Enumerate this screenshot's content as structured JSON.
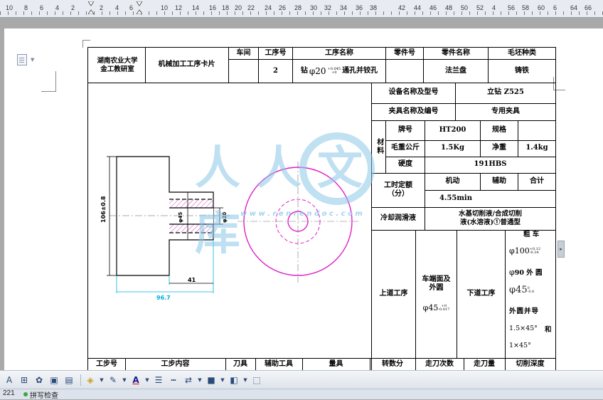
{
  "ruler": {
    "labels": [
      "10",
      "8",
      "6",
      "4",
      "2",
      "2",
      "4",
      "6",
      "10",
      "12",
      "14",
      "16",
      "18",
      "20",
      "22",
      "24",
      "26",
      "28",
      "30",
      "32",
      "34",
      "36",
      "38",
      "42",
      "44",
      "46",
      "48",
      "50",
      "52",
      "4",
      "56",
      "58",
      "60",
      "6",
      "64",
      "66"
    ]
  },
  "card": {
    "school": "湖南农业大学\n金工教研室",
    "card_title": "机械加工工序卡片",
    "head_workshop": "车间",
    "head_op_no": "工序号",
    "head_op_name": "工序名称",
    "head_part_no": "零件号",
    "head_part_name": "零件名称",
    "head_blank": "毛坯种类",
    "val_workshop": "",
    "val_op_no": "2",
    "val_op_name_a": "钻",
    "val_op_name_b": "20",
    "val_op_name_tol_up": "+0.045",
    "val_op_name_tol_dn": "+0",
    "val_op_name_c": "通孔并铰孔",
    "val_part_no": "",
    "val_part_name": "法兰盘",
    "val_blank": "铸铁",
    "equip_label": "设备名称及型号",
    "equip_value": "立钻 Z525",
    "fixture_label": "夹具名称及编号",
    "fixture_value": "专用夹具",
    "material_label": "材料",
    "grade_label": "牌号",
    "grade_value": "HT200",
    "spec_label": "规格",
    "spec_value": "",
    "gross_label": "毛重公斤",
    "gross_value": "1.5Kg",
    "net_label": "净重",
    "net_value": "1.4kg",
    "hardness_label": "硬度",
    "hardness_value": "191HBS",
    "time_label": "工时定额\n（分）",
    "time_machine": "机动",
    "time_aux": "辅助",
    "time_total": "合计",
    "time_machine_value": "4.55min",
    "coolant_label": "冷却润滑液",
    "coolant_value": "水基切削液/合成切削\n液(水溶液)①普通型",
    "prev_op": "上道工序",
    "this_op": "车端面及\n外圆",
    "this_op_dim": "45",
    "this_op_tol_up": "+0",
    "this_op_tol_dn": "-0.017",
    "next_op": "下道工序",
    "next_op_rough": "粗  车",
    "next_op_d100": "100",
    "next_op_d100_up": "+0.12",
    "next_op_d100_dn": "-0.34",
    "next_op_d90": "90  外 圆",
    "next_op_d45": "45",
    "next_op_d45_up": "0",
    "next_op_d45_dn": "-0.6",
    "next_op_outer": "外圆并导",
    "next_op_chamfer1": "1.5×45°",
    "next_op_and": "和",
    "next_op_chamfer2": "1×45°",
    "footer": [
      "工步号",
      "工步内容",
      "刀具",
      "辅助工具",
      "量具",
      "转数分",
      "走刀次数",
      "走刀量",
      "切削深度"
    ]
  },
  "drawing": {
    "dim_height": "106±0.8",
    "dim_bore": "φ45",
    "dim_hole": "φ20",
    "dim_len1": "41",
    "dim_len2": "96.7"
  },
  "watermark": {
    "text": "人人文库",
    "url": "w w w . r e n r e n d o c . c o m"
  },
  "status": {
    "page": "221",
    "spell": "拼写检查"
  },
  "colors": {
    "accent_magenta": "#e020c8",
    "accent_cyan": "#00b0e0",
    "watermark_blue": "#8cc8e8"
  }
}
